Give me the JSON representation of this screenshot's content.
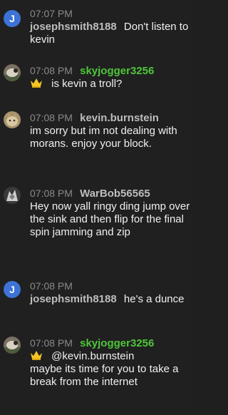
{
  "messages": [
    {
      "avatar": {
        "type": "initial",
        "letter": "J",
        "color": "#3c73d6"
      },
      "time": "07:07 PM",
      "username": "josephsmith8188",
      "text": "Don't listen to kevin"
    },
    {
      "avatar": {
        "type": "photo",
        "icon": "sheep-avatar-icon"
      },
      "time": "07:08 PM",
      "username": "skyjogger3256",
      "username_color": "#4fc63b",
      "badge_icon": "crown-icon",
      "text": "is kevin a troll?"
    },
    {
      "avatar": {
        "type": "photo",
        "icon": "cat-avatar-icon"
      },
      "time": "07:08 PM",
      "username": "kevin.burnstein",
      "text": "im sorry but im not dealing with morans. enjoy your block."
    },
    {
      "avatar": {
        "type": "photo",
        "icon": "armored-avatar-icon"
      },
      "time": "07:08 PM",
      "username": "WarBob56565",
      "text": "Hey now yall ringy ding jump over the sink and then flip for the final spin jamming and zip"
    },
    {
      "avatar": {
        "type": "initial",
        "letter": "J",
        "color": "#3c73d6"
      },
      "time": "07:08 PM",
      "username": "josephsmith8188",
      "text": "he's a dunce"
    },
    {
      "avatar": {
        "type": "photo",
        "icon": "sheep-avatar-icon"
      },
      "time": "07:08 PM",
      "username": "skyjogger3256",
      "username_color": "#4fc63b",
      "badge_icon": "crown-icon",
      "mention": "@kevin.burnstein",
      "text": "maybe its time for you to take a break from the internet"
    }
  ]
}
